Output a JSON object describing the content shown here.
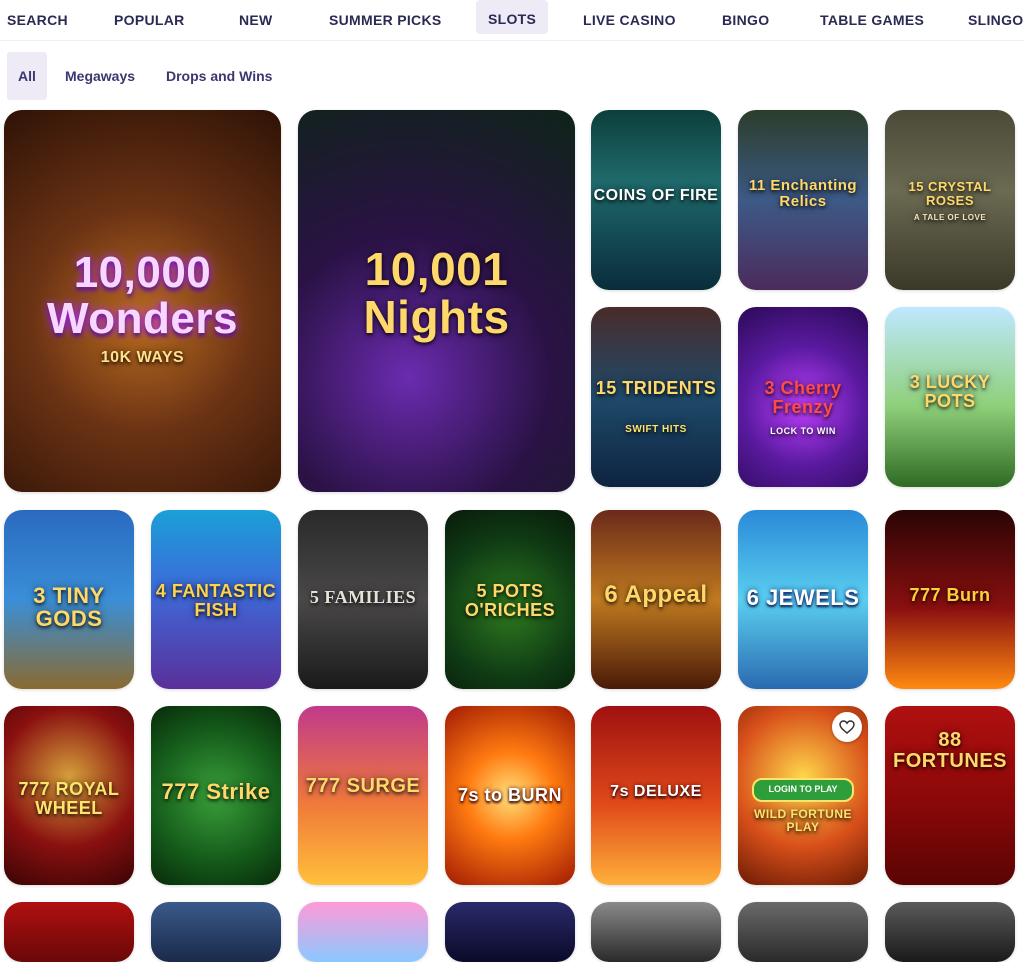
{
  "nav": {
    "items": [
      "SEARCH",
      "POPULAR",
      "NEW",
      "SUMMER PICKS",
      "SLOTS",
      "LIVE CASINO",
      "BINGO",
      "TABLE GAMES",
      "SLINGO"
    ],
    "active": "SLOTS"
  },
  "subnav": {
    "items": [
      "All",
      "Megaways",
      "Drops and Wins"
    ],
    "active": "All"
  },
  "games": [
    {
      "title": "10,000 Wonders",
      "sub": "10K WAYS"
    },
    {
      "title": "10,001 Nights",
      "sub": ""
    },
    {
      "title": "COINS OF FIRE",
      "sub": ""
    },
    {
      "title": "11 Enchanting Relics",
      "sub": ""
    },
    {
      "title": "15 CRYSTAL ROSES",
      "sub": "A TALE OF LOVE"
    },
    {
      "title": "15 TRIDENTS",
      "sub": "SWIFT HITS"
    },
    {
      "title": "3 Cherry Frenzy",
      "sub": "LOCK TO WIN"
    },
    {
      "title": "3 LUCKY POTS",
      "sub": ""
    },
    {
      "title": "3 TINY GODS",
      "sub": ""
    },
    {
      "title": "4 FANTASTIC FISH",
      "sub": ""
    },
    {
      "title": "5 FAMILIES",
      "sub": ""
    },
    {
      "title": "5 POTS O'RICHES",
      "sub": ""
    },
    {
      "title": "6 Appeal",
      "sub": ""
    },
    {
      "title": "6 JEWELS",
      "sub": ""
    },
    {
      "title": "777 Burn",
      "sub": ""
    },
    {
      "title": "777 ROYAL WHEEL",
      "sub": ""
    },
    {
      "title": "777 Strike",
      "sub": ""
    },
    {
      "title": "777 SURGE",
      "sub": ""
    },
    {
      "title": "7s to BURN",
      "sub": ""
    },
    {
      "title": "7s DELUXE",
      "sub": ""
    },
    {
      "title": "WILD FORTUNE PLAY",
      "sub": "",
      "button": "LOGIN TO PLAY"
    },
    {
      "title": "88 FORTUNES",
      "sub": ""
    }
  ],
  "colors": {
    "nav_text": "#2b2a55",
    "active_bg": "#eeeaf6"
  },
  "icons": {
    "favorite": "heart-outline-icon"
  }
}
